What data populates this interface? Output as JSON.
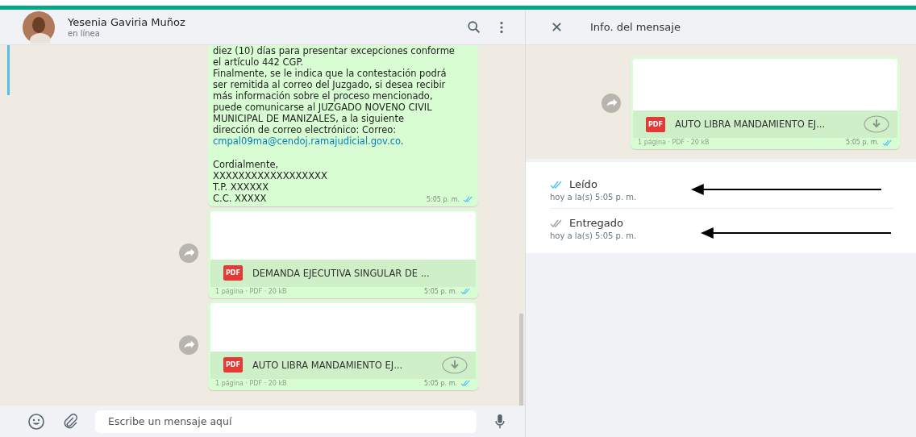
{
  "chat": {
    "contact_name": "Yesenia Gaviria Muñoz",
    "status": "en línea",
    "text_message": {
      "lines": [
        {
          "kind": "text",
          "text": "diez (10) días para presentar excepciones conforme"
        },
        {
          "kind": "text",
          "text": "el artículo 442 CGP."
        },
        {
          "kind": "text",
          "text": "Finalmente, se le indica que la contestación podrá"
        },
        {
          "kind": "text",
          "text": "ser remitida al correo del Juzgado, si desea recibir"
        },
        {
          "kind": "text",
          "text": "más información sobre el proceso mencionado,"
        },
        {
          "kind": "text",
          "text": "puede comunicarse al JUZGADO NOVENO CIVIL"
        },
        {
          "kind": "text",
          "text": "MUNICIPAL DE MANIZALES, a la siguiente"
        },
        {
          "kind": "text",
          "text": "dirección de correo electrónico: Correo:"
        },
        {
          "kind": "link",
          "text": "cmpal09ma@cendoj.ramajudicial.gov.co",
          "after": "."
        },
        {
          "kind": "blank"
        },
        {
          "kind": "text",
          "text": "Cordialmente,"
        },
        {
          "kind": "text",
          "text": "XXXXXXXXXXXXXXXXXX"
        },
        {
          "kind": "text",
          "text": "T.P. XXXXXX"
        },
        {
          "kind": "text",
          "text": "C.C. XXXXX"
        }
      ],
      "time": "5:05 p. m.",
      "read": true
    },
    "file_messages": [
      {
        "file_name": "DEMANDA EJECUTIVA SINGULAR DE ...",
        "file_type": "PDF",
        "meta": "1 página · PDF · 20 kB",
        "time": "5:05 p. m.",
        "read": true,
        "download": false
      },
      {
        "file_name": "AUTO LIBRA MANDAMIENTO EJ...",
        "file_type": "PDF",
        "meta": "1 página · PDF · 20 kB",
        "time": "5:05 p. m.",
        "read": true,
        "download": true
      }
    ],
    "composer": {
      "placeholder": "Escribe un mensaje aquí"
    }
  },
  "message_info": {
    "title": "Info. del mensaje",
    "message": {
      "file_name": "AUTO LIBRA MANDAMIENTO EJ...",
      "file_type": "PDF",
      "meta": "1 página · PDF · 20 kB",
      "time": "5:05 p. m.",
      "read": true,
      "download": true
    },
    "receipts": [
      {
        "kind": "read",
        "label": "Leído",
        "time": "hoy a la(s) 5:05 p. m."
      },
      {
        "kind": "delivered",
        "label": "Entregado",
        "time": "hoy a la(s) 5:05 p. m."
      }
    ]
  }
}
